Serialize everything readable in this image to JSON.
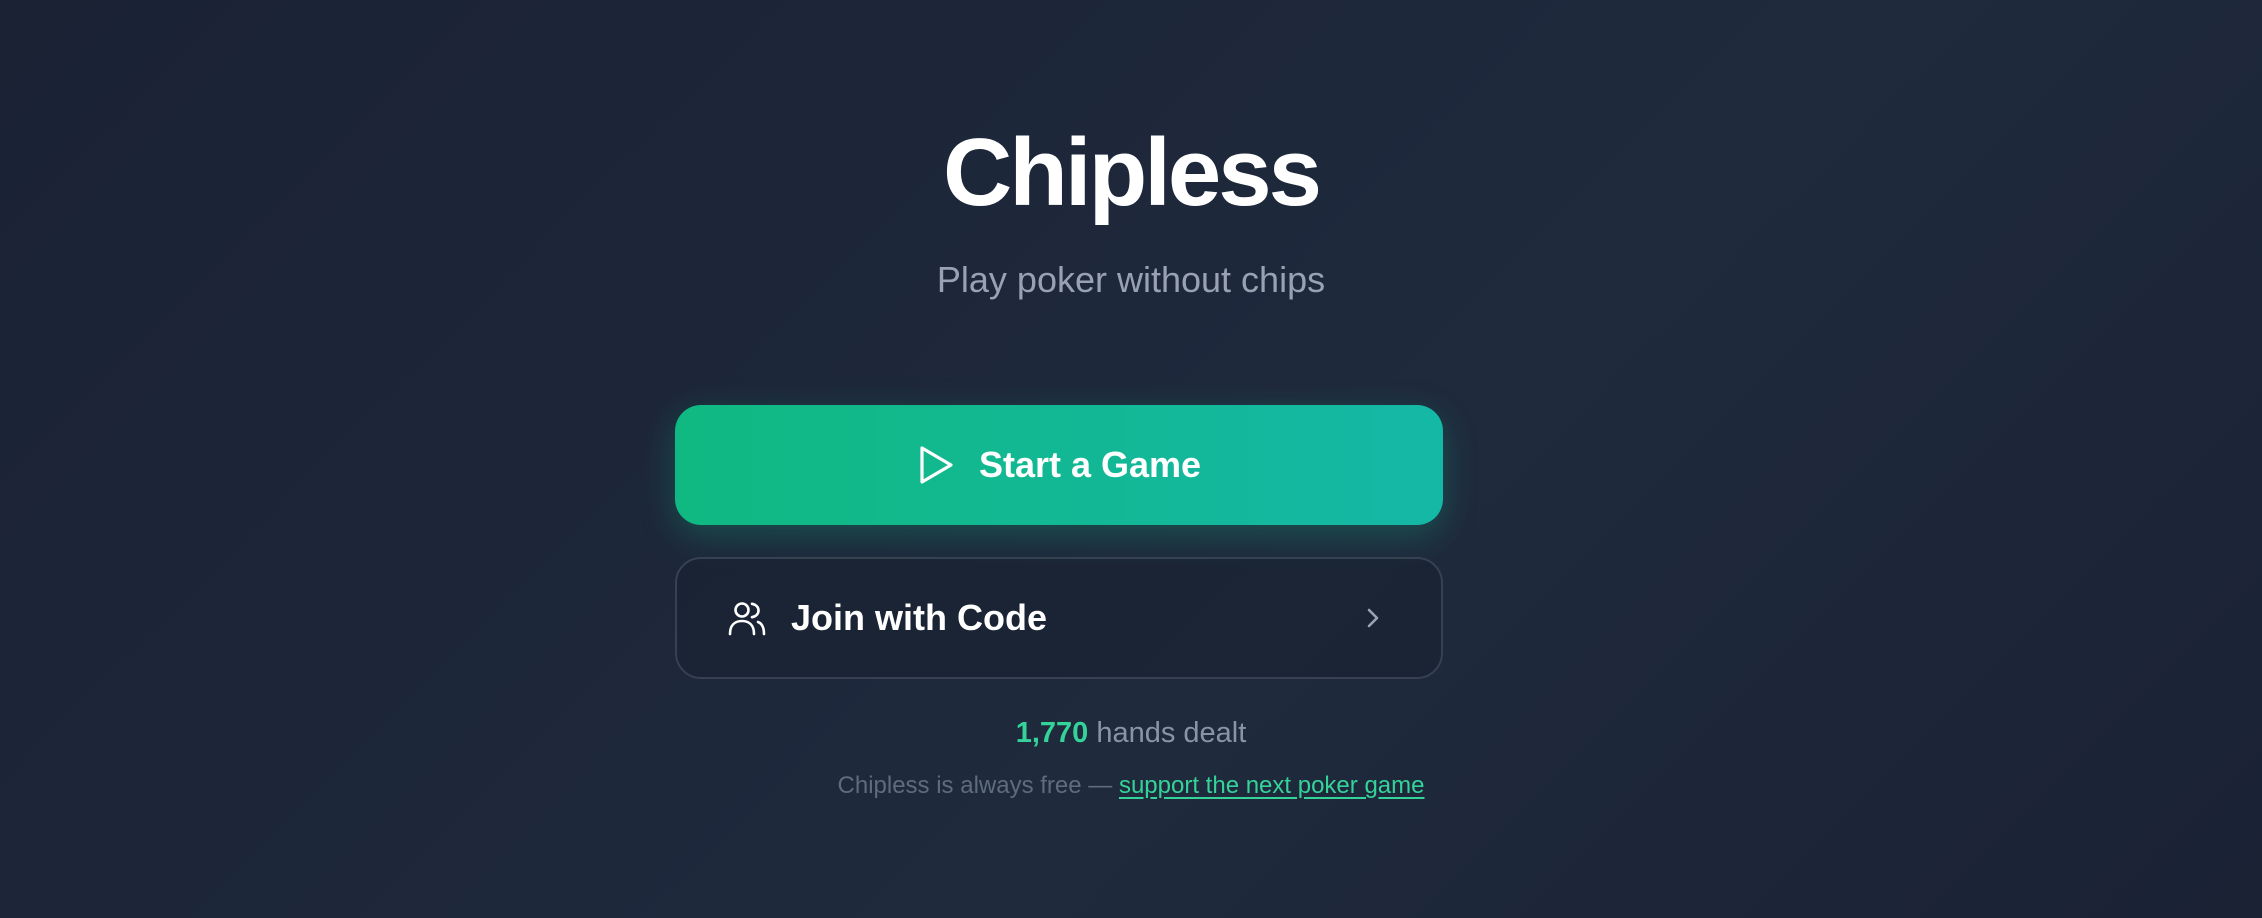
{
  "app": {
    "title": "Chipless",
    "subtitle": "Play poker without chips"
  },
  "actions": {
    "start_label": "Start a Game",
    "start_icon": "play-icon",
    "join_label": "Join with Code",
    "join_icon": "users-icon",
    "join_chevron_icon": "chevron-right-icon"
  },
  "stats": {
    "hands_count": "1,770",
    "hands_suffix": "hands dealt"
  },
  "footer": {
    "note_prefix": "Chipless is always free —",
    "support_link": "support the next poker game"
  },
  "colors": {
    "accent": "#10b981",
    "accent_end": "#14b8a6",
    "accent_text": "#34d399",
    "background": "#1a2234"
  }
}
